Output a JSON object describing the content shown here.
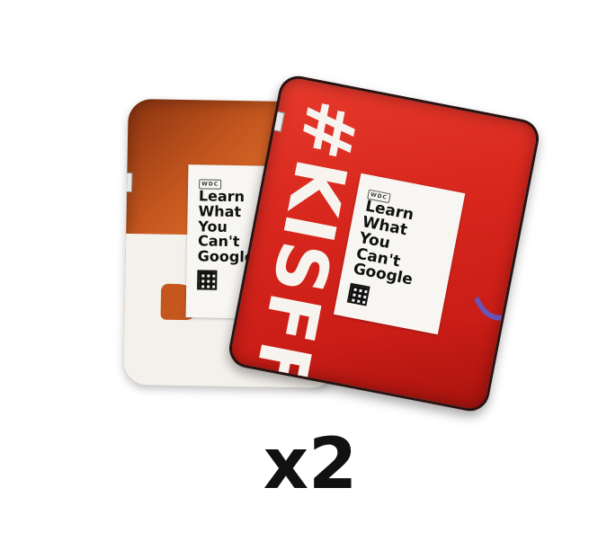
{
  "product": {
    "back_pad": {
      "card_brand": "WDC",
      "card_lines": [
        "Learn",
        "What",
        "You",
        "Can't",
        "Google"
      ]
    },
    "front_pad": {
      "hashtag": "#KISFF",
      "card_brand": "WDC",
      "card_lines": [
        "Learn",
        "What",
        "You",
        "Can't",
        "Google"
      ]
    }
  },
  "quantity_label": "x2",
  "colors": {
    "back_pad": "#c4561e",
    "front_pad": "#d8271d",
    "card": "#f7f6f2",
    "accent_arc": "#5a5fd1"
  }
}
